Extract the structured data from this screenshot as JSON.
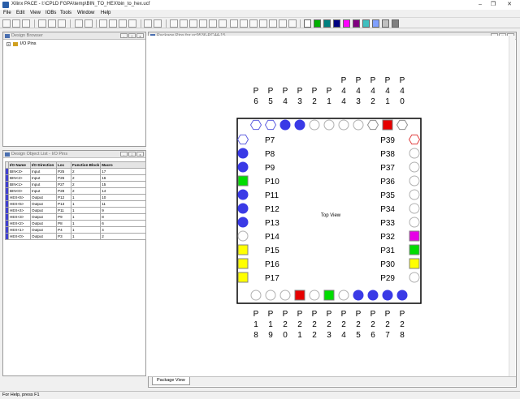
{
  "window": {
    "title": "Xilinx PACE - I:\\CPLD FGPA\\temp\\BIN_TO_HEX\\bin_to_hex.ucf",
    "min": "–",
    "max": "❐",
    "close": "✕"
  },
  "menu": [
    "File",
    "Edit",
    "View",
    "IOBs",
    "Tools",
    "Window",
    "Help"
  ],
  "toolbar": {
    "colors": [
      "#ffffff",
      "#00b000",
      "#008080",
      "#000080",
      "#ff00ff",
      "#800080",
      "#40c0c0",
      "#80a0ff",
      "#c0c0c0",
      "#808080"
    ]
  },
  "design_browser": {
    "title": "Design Browser",
    "tree_item": "I/O Pins"
  },
  "object_list": {
    "title": "Design Object List - I/O Pins",
    "columns": [
      "I/O Name",
      "I/O Direction",
      "Loc",
      "Function Block",
      "Macro"
    ],
    "rows": [
      [
        "BIN<3>",
        "Input",
        "P25",
        "2",
        "17"
      ],
      [
        "BIN<2>",
        "Input",
        "P26",
        "2",
        "16"
      ],
      [
        "BIN<1>",
        "Input",
        "P27",
        "2",
        "15"
      ],
      [
        "BIN<0>",
        "Input",
        "P28",
        "2",
        "14"
      ],
      [
        "HEX<6>",
        "Output",
        "P12",
        "1",
        "10"
      ],
      [
        "HEX<5>",
        "Output",
        "P13",
        "1",
        "11"
      ],
      [
        "HEX<4>",
        "Output",
        "P11",
        "1",
        "9"
      ],
      [
        "HEX<3>",
        "Output",
        "P9",
        "1",
        "8"
      ],
      [
        "HEX<2>",
        "Output",
        "P8",
        "1",
        "6"
      ],
      [
        "HEX<1>",
        "Output",
        "P4",
        "1",
        "4"
      ],
      [
        "HEX<0>",
        "Output",
        "P3",
        "1",
        "2"
      ]
    ]
  },
  "package": {
    "title": "Package Pins for xc9536-PC44-15",
    "center_label": "Top View",
    "tab": "Package View",
    "top_labels": [
      [
        "P",
        "6"
      ],
      [
        "P",
        "5"
      ],
      [
        "P",
        "4"
      ],
      [
        "P",
        "3"
      ],
      [
        "P",
        "2"
      ],
      [
        "P",
        "1"
      ],
      [
        "P",
        "4",
        "4"
      ],
      [
        "P",
        "4",
        "3"
      ],
      [
        "P",
        "4",
        "2"
      ],
      [
        "P",
        "4",
        "1"
      ],
      [
        "P",
        "4",
        "0"
      ]
    ],
    "bottom_labels": [
      [
        "P",
        "1",
        "8"
      ],
      [
        "P",
        "1",
        "9"
      ],
      [
        "P",
        "2",
        "0"
      ],
      [
        "P",
        "2",
        "1"
      ],
      [
        "P",
        "2",
        "2"
      ],
      [
        "P",
        "2",
        "3"
      ],
      [
        "P",
        "2",
        "4"
      ],
      [
        "P",
        "2",
        "5"
      ],
      [
        "P",
        "2",
        "6"
      ],
      [
        "P",
        "2",
        "7"
      ],
      [
        "P",
        "2",
        "8"
      ]
    ],
    "left_labels": [
      "P7",
      "P8",
      "P9",
      "P10",
      "P11",
      "P12",
      "P13",
      "P14",
      "P15",
      "P16",
      "P17"
    ],
    "right_labels": [
      "P39",
      "P38",
      "P37",
      "P36",
      "P35",
      "P34",
      "P33",
      "P32",
      "P31",
      "P30",
      "P29"
    ],
    "top_pins": [
      "hex-blue",
      "hex-blue",
      "circle-blue",
      "circle-blue",
      "circle",
      "circle",
      "circle",
      "circle",
      "hex-gray",
      "square-red",
      "hex-gray"
    ],
    "bottom_pins": [
      "circle",
      "circle",
      "circle",
      "square-red",
      "circle",
      "square-green",
      "circle",
      "circle-blue",
      "circle-blue",
      "circle-blue",
      "circle-blue"
    ],
    "left_pins": [
      "hex-blue",
      "circle-blue",
      "circle-blue",
      "square-green",
      "circle-blue",
      "circle-blue",
      "circle-blue",
      "circle",
      "square-yellow",
      "square-yellow",
      "square-yellow"
    ],
    "right_pins": [
      "hex-red",
      "circle",
      "circle",
      "circle",
      "circle",
      "circle",
      "circle",
      "square-magenta",
      "square-green",
      "square-yellow",
      "circle"
    ],
    "colors": {
      "blue": "#3a3ae6",
      "red": "#e60000",
      "green": "#00dc00",
      "yellow": "#ffff00",
      "magenta": "#e600e6"
    }
  },
  "status": "For Help, press F1"
}
